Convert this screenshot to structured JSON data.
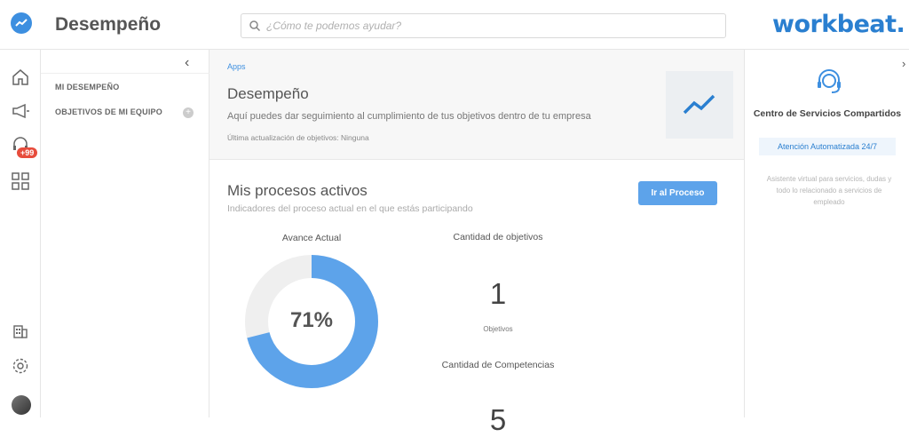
{
  "header": {
    "page_title": "Desempeño",
    "search_placeholder": "¿Cómo te podemos ayudar?",
    "brand": "workbeat",
    "brand_dot": "."
  },
  "rail": {
    "notifications_badge": "+99"
  },
  "subnav": {
    "items": [
      "MI DESEMPEÑO",
      "OBJETIVOS DE MI EQUIPO"
    ]
  },
  "hero": {
    "breadcrumb": "Apps",
    "title": "Desempeño",
    "subtitle": "Aquí puedes dar seguimiento al cumplimiento de tus objetivos dentro de tu empresa",
    "last_update": "Última actualización de objetivos: Ninguna"
  },
  "processes": {
    "title": "Mis procesos activos",
    "subtitle": "Indicadores del proceso actual en el que estás participando",
    "button_label": "Ir al Proceso",
    "progress_label": "Avance Actual",
    "progress_value": "71%",
    "progress_fraction": 0.71,
    "objectives_label": "Cantidad de objetivos",
    "objectives_value": "1",
    "objectives_unit": "Objetivos",
    "competencies_label": "Cantidad de Competencias",
    "competencies_value": "5"
  },
  "right_panel": {
    "title": "Centro de Servicios Compartidos",
    "chip": "Atención Automatizada 24/7",
    "description": "Asistente virtual para servicios, dudas y todo lo relacionado a servicios de empleado"
  },
  "colors": {
    "accent": "#3d8fe0",
    "donut_fill": "#5da3ea",
    "donut_track": "#efefef",
    "badge": "#e74c3c"
  }
}
